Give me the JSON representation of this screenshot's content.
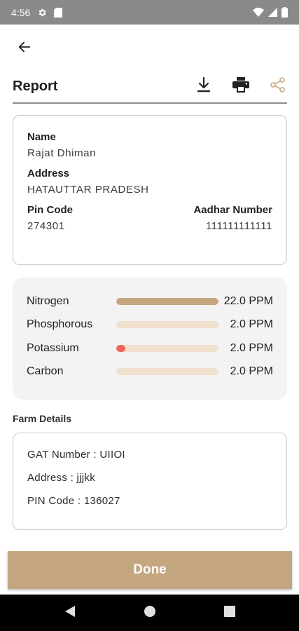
{
  "status_bar": {
    "time": "4:56"
  },
  "header": {
    "title": "Report"
  },
  "user": {
    "name_label": "Name",
    "name_value": "Rajat Dhiman",
    "address_label": "Address",
    "address_value": "HATAUTTAR PRADESH",
    "pin_label": "Pin Code",
    "pin_value": "274301",
    "aadhar_label": "Aadhar Number",
    "aadhar_value": "111111111111"
  },
  "nutrients": [
    {
      "name": "Nitrogen",
      "value": "22.0 PPM",
      "level": 1.0,
      "color": "#c4a680"
    },
    {
      "name": "Phosphorous",
      "value": "2.0 PPM",
      "level": 0.0,
      "color": "#c4a680"
    },
    {
      "name": "Potassium",
      "value": "2.0 PPM",
      "level": 0.09,
      "color": "#f2675a"
    },
    {
      "name": "Carbon",
      "value": "2.0 PPM",
      "level": 0.0,
      "color": "#c4a680"
    }
  ],
  "farm": {
    "heading": "Farm Details",
    "gat": "GAT Number : UIIOI",
    "address": "Address : jjjkk",
    "pin": "PIN Code : 136027"
  },
  "done_label": "Done",
  "colors": {
    "accent": "#c4a680",
    "track": "#f1dfcf",
    "low": "#f2675a"
  },
  "icons": {
    "back": "arrow-left-icon",
    "download": "download-icon",
    "print": "printer-icon",
    "share": "share-icon"
  }
}
